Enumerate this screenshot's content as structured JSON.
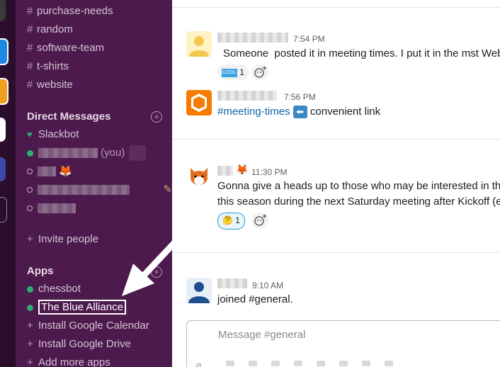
{
  "sidebar": {
    "channels": [
      {
        "label": "purchase-needs"
      },
      {
        "label": "random"
      },
      {
        "label": "software-team"
      },
      {
        "label": "t-shirts"
      },
      {
        "label": "website"
      }
    ],
    "dm_section": {
      "title": "Direct Messages"
    },
    "dms": [
      {
        "label": "Slackbot"
      },
      {
        "suffix": "(you)"
      }
    ],
    "invite": {
      "label": "Invite people"
    },
    "apps_section": {
      "title": "Apps"
    },
    "apps": [
      {
        "label": "chessbot"
      },
      {
        "label": "The Blue Alliance"
      }
    ],
    "install": [
      {
        "label": "Install Google Calendar"
      },
      {
        "label": "Install Google Drive"
      },
      {
        "label": "Add more apps"
      }
    ]
  },
  "messages": [
    {
      "time": "7:54 PM",
      "name_overlay": "Someone",
      "text": "posted it in meeting times. I put it in the mst Web",
      "reaction_count": "1"
    },
    {
      "time": "7:56 PM",
      "channel_link": "#meeting-times",
      "text": "convenient link"
    },
    {
      "time": "11:30 PM",
      "line1": "Gonna give a heads up to those who may be interested in the",
      "line2": "this season during the next Saturday meeting after Kickoff (er",
      "reaction_count": "1"
    },
    {
      "time": "9:10 AM",
      "text": "joined #general."
    }
  ],
  "composer": {
    "placeholder": "Message #general"
  },
  "colors": {
    "sidebar": "#4d1a4d",
    "rail": "#2b0e2b",
    "online": "#2bac76",
    "link": "#1264a3",
    "highlight_box": "#ffffff"
  }
}
